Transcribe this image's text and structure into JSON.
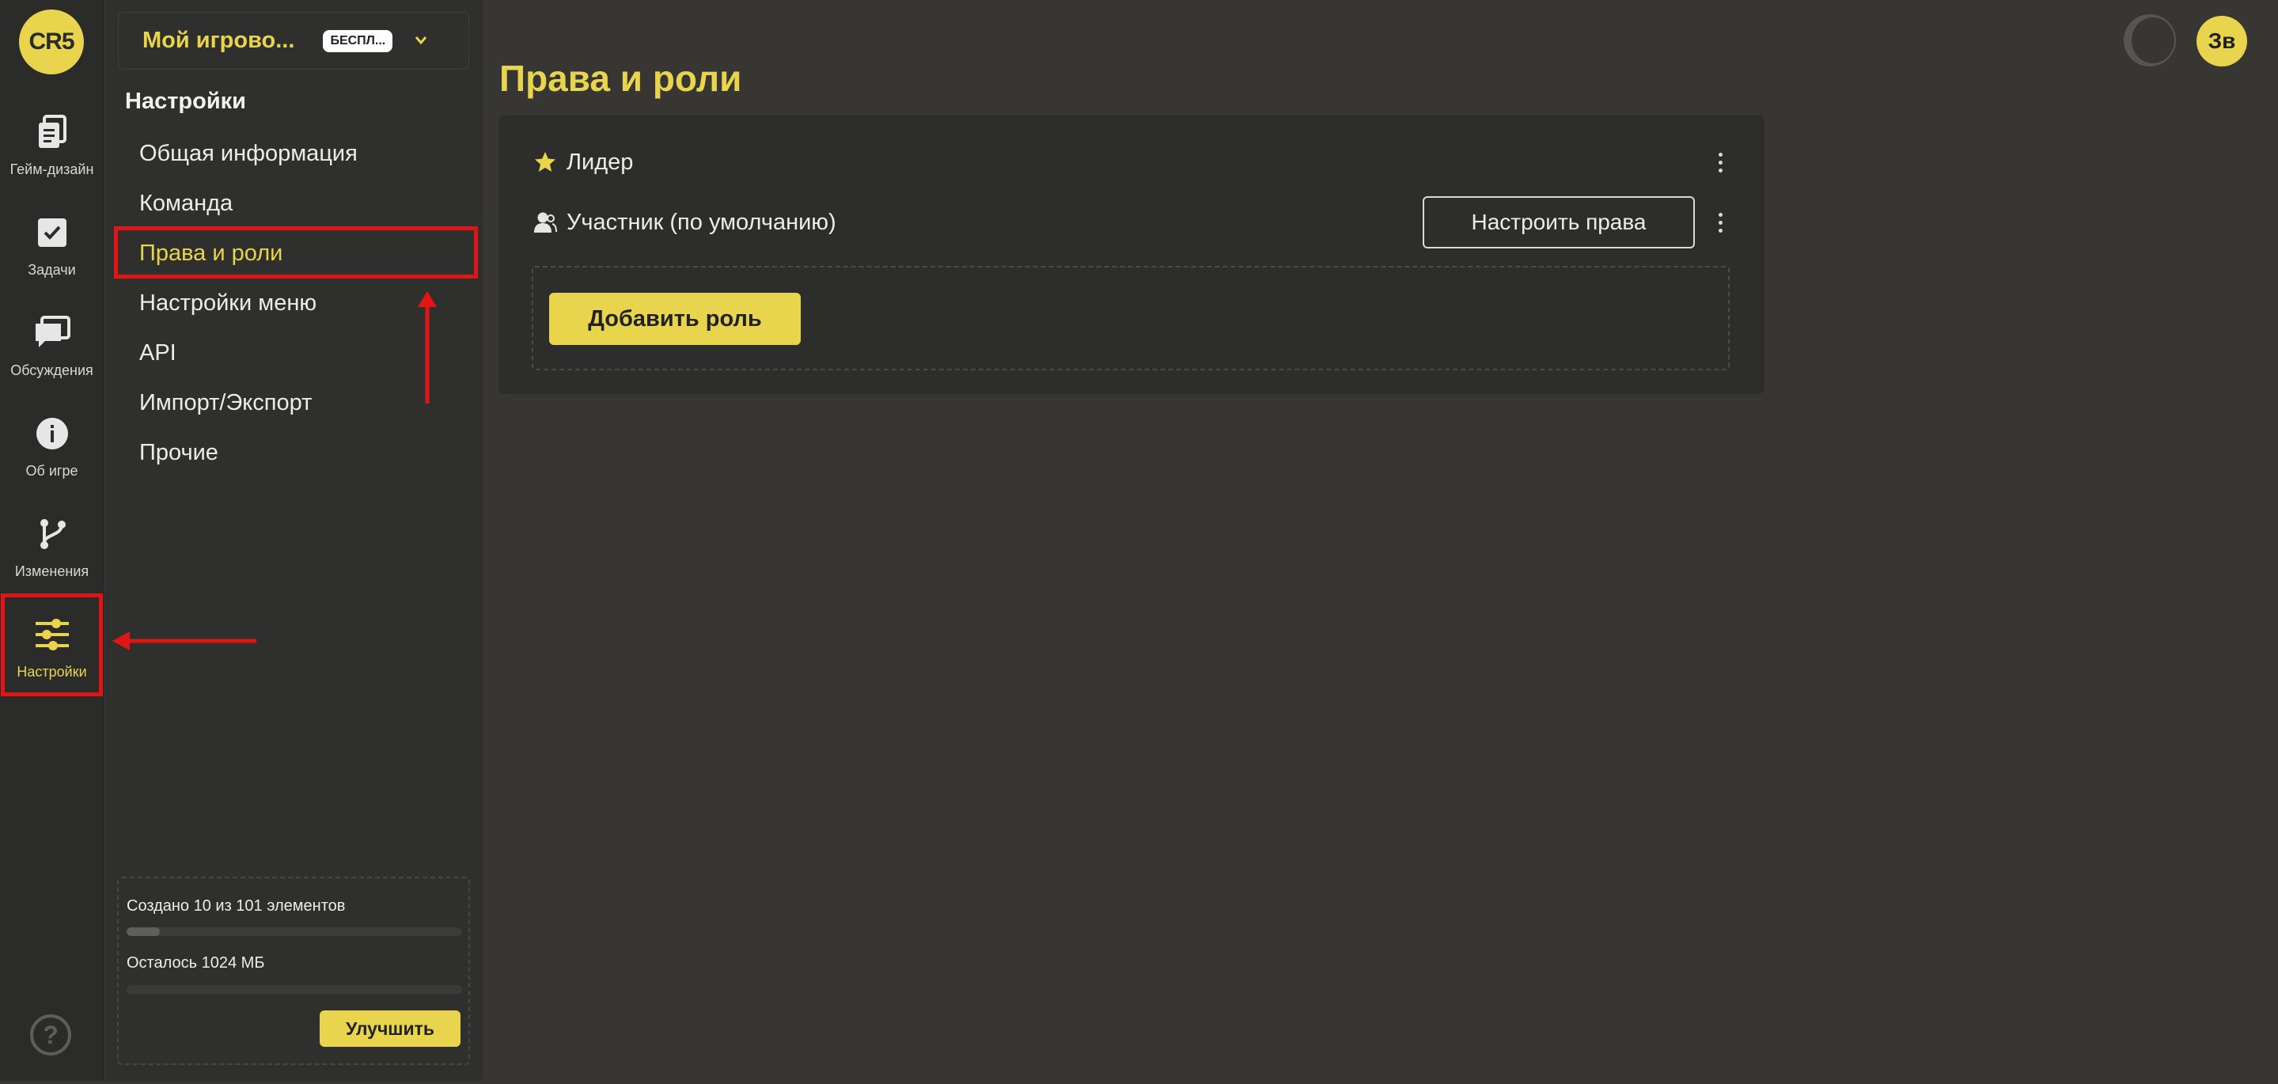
{
  "app": {
    "logo_text": "CR5",
    "theme_icon": "moon-icon",
    "avatar_initials": "Зв",
    "accent_color": "#e8d44d",
    "annotation_color": "#e01515"
  },
  "rail": {
    "items": [
      {
        "label": "Гейм-дизайн",
        "icon": "document-icon"
      },
      {
        "label": "Задачи",
        "icon": "checkbox-icon"
      },
      {
        "label": "Обсуждения",
        "icon": "chat-icon"
      },
      {
        "label": "Об игре",
        "icon": "info-icon"
      },
      {
        "label": "Изменения",
        "icon": "branch-icon"
      },
      {
        "label": "Настройки",
        "icon": "sliders-icon",
        "active": true
      }
    ],
    "help_icon": "?"
  },
  "sidebar": {
    "project_name": "Мой игрово...",
    "plan_badge": "БЕСПЛ...",
    "title": "Настройки",
    "menu": [
      {
        "label": "Общая информация"
      },
      {
        "label": "Команда"
      },
      {
        "label": "Права и роли",
        "active": true
      },
      {
        "label": "Настройки меню"
      },
      {
        "label": "API"
      },
      {
        "label": "Импорт/Экспорт"
      },
      {
        "label": "Прочие"
      }
    ],
    "quota": {
      "elements_text": "Создано 10 из 101 элементов",
      "elements_fraction": 0.099,
      "storage_text": "Осталось 1024 МБ",
      "storage_fraction": 0,
      "upgrade_label": "Улучшить"
    }
  },
  "main": {
    "title": "Права и роли",
    "roles": [
      {
        "label": "Лидер",
        "icon": "star-icon"
      },
      {
        "label": "Участник (по умолчанию)",
        "icon": "user-icon",
        "configure_label": "Настроить права"
      }
    ],
    "add_role_label": "Добавить роль"
  }
}
